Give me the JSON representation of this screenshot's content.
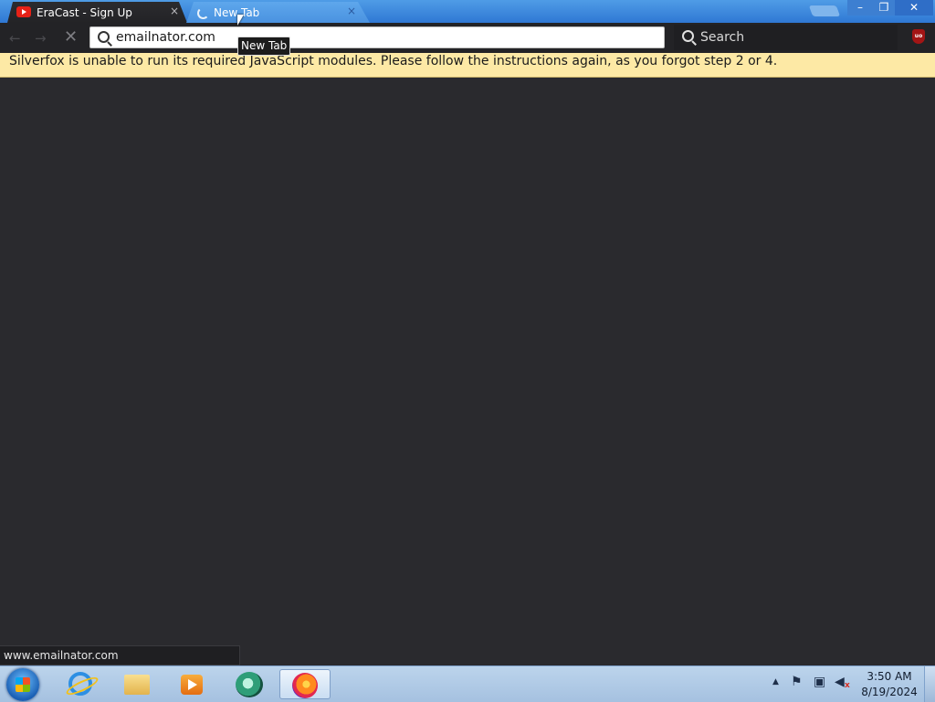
{
  "browser": {
    "name": "Silverfox",
    "tabs": [
      {
        "title": "EraCast - Sign Up",
        "icon": "youtube-icon",
        "active": false
      },
      {
        "title": "New Tab",
        "icon": "loading-spinner-icon",
        "active": true
      }
    ],
    "tab_close_glyph": "×",
    "tooltip": "New Tab",
    "window_controls": {
      "minimize": "–",
      "maximize": "❐",
      "close": "✕"
    },
    "nav": {
      "back": "←",
      "forward": "→",
      "stop": "✕"
    },
    "url": "emailnator.com",
    "search_placeholder": "Search",
    "extension_badge": "uo",
    "notification": "Silverfox is unable to run its required JavaScript modules. Please follow the instructions again, as you forgot step 2 or 4.",
    "status_link": "www.emailnator.com"
  },
  "taskbar": {
    "apps": [
      {
        "name": "internet-explorer",
        "icon": "ie-icon"
      },
      {
        "name": "file-explorer",
        "icon": "folder-icon"
      },
      {
        "name": "media-player",
        "icon": "media-player-icon"
      },
      {
        "name": "green-app",
        "icon": "green-app-icon"
      },
      {
        "name": "firefox",
        "icon": "firefox-icon",
        "active": true
      }
    ],
    "tray": {
      "up_arrow": "▲",
      "flag": "⚑",
      "network": "▣",
      "volume": "◀"
    },
    "time": "3:50 AM",
    "date": "8/19/2024"
  },
  "colors": {
    "content_bg": "#2a2a2e",
    "notification_bg": "#fde9a5",
    "titlebar": "#3d86dc"
  }
}
